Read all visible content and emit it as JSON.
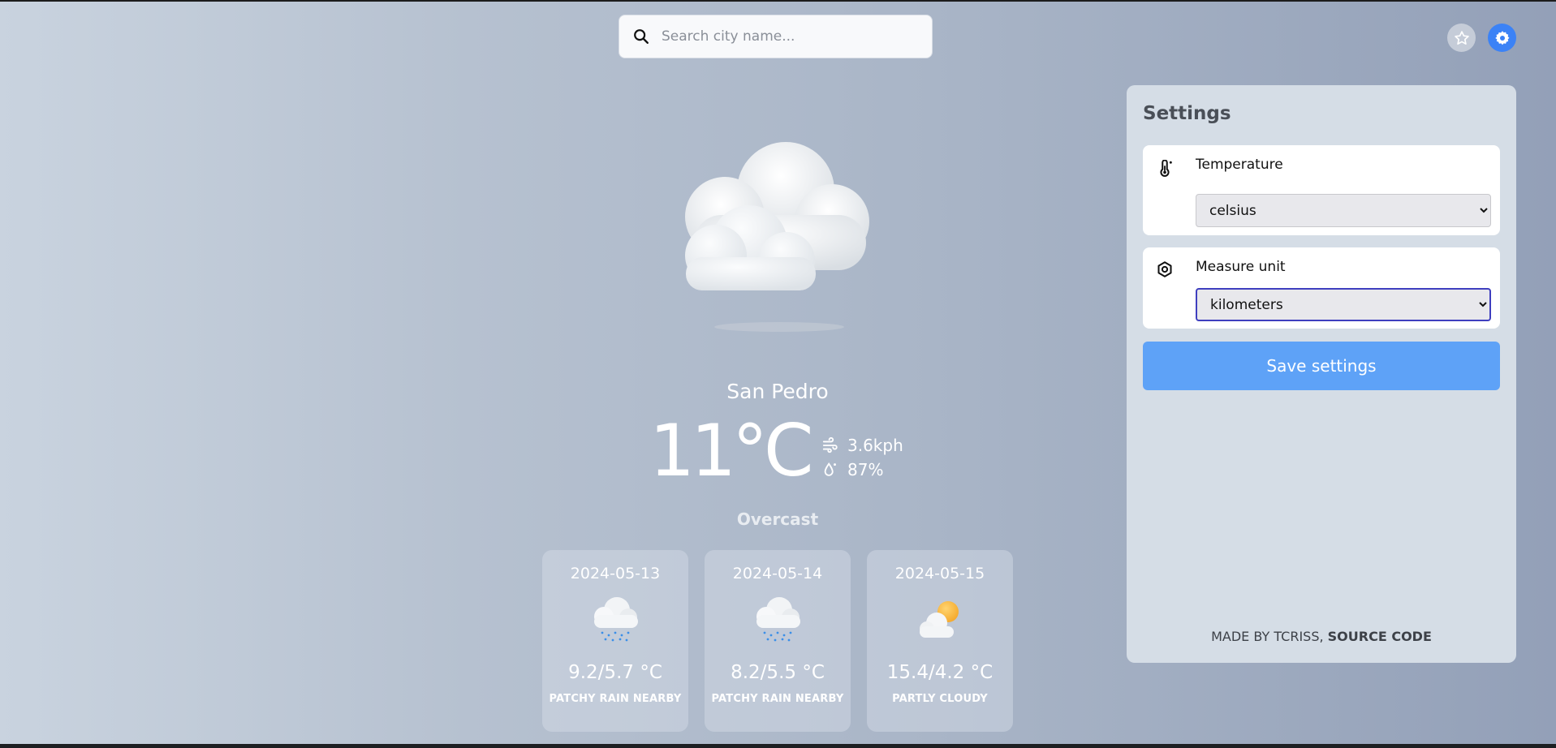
{
  "search": {
    "placeholder": "Search city name..."
  },
  "current": {
    "city": "San Pedro",
    "temperature": "11°C",
    "wind": "3.6kph",
    "humidity": "87%",
    "condition": "Overcast"
  },
  "forecast": [
    {
      "date": "2024-05-13",
      "range": "9.2/5.7 °C",
      "condition": "PATCHY RAIN NEARBY",
      "icon": "rain-cloud-icon"
    },
    {
      "date": "2024-05-14",
      "range": "8.2/5.5 °C",
      "condition": "PATCHY RAIN NEARBY",
      "icon": "rain-cloud-icon"
    },
    {
      "date": "2024-05-15",
      "range": "15.4/4.2 °C",
      "condition": "PARTLY CLOUDY",
      "icon": "partly-cloudy-icon"
    }
  ],
  "settings": {
    "title": "Settings",
    "temperature": {
      "label": "Temperature",
      "value": "celsius"
    },
    "measure": {
      "label": "Measure unit",
      "value": "kilometers"
    },
    "save_label": "Save settings",
    "footer_prefix": "MADE BY TCRISS, ",
    "footer_link": "SOURCE CODE"
  },
  "colors": {
    "accent": "#3b82f6",
    "save_button": "#5ea2f7"
  }
}
